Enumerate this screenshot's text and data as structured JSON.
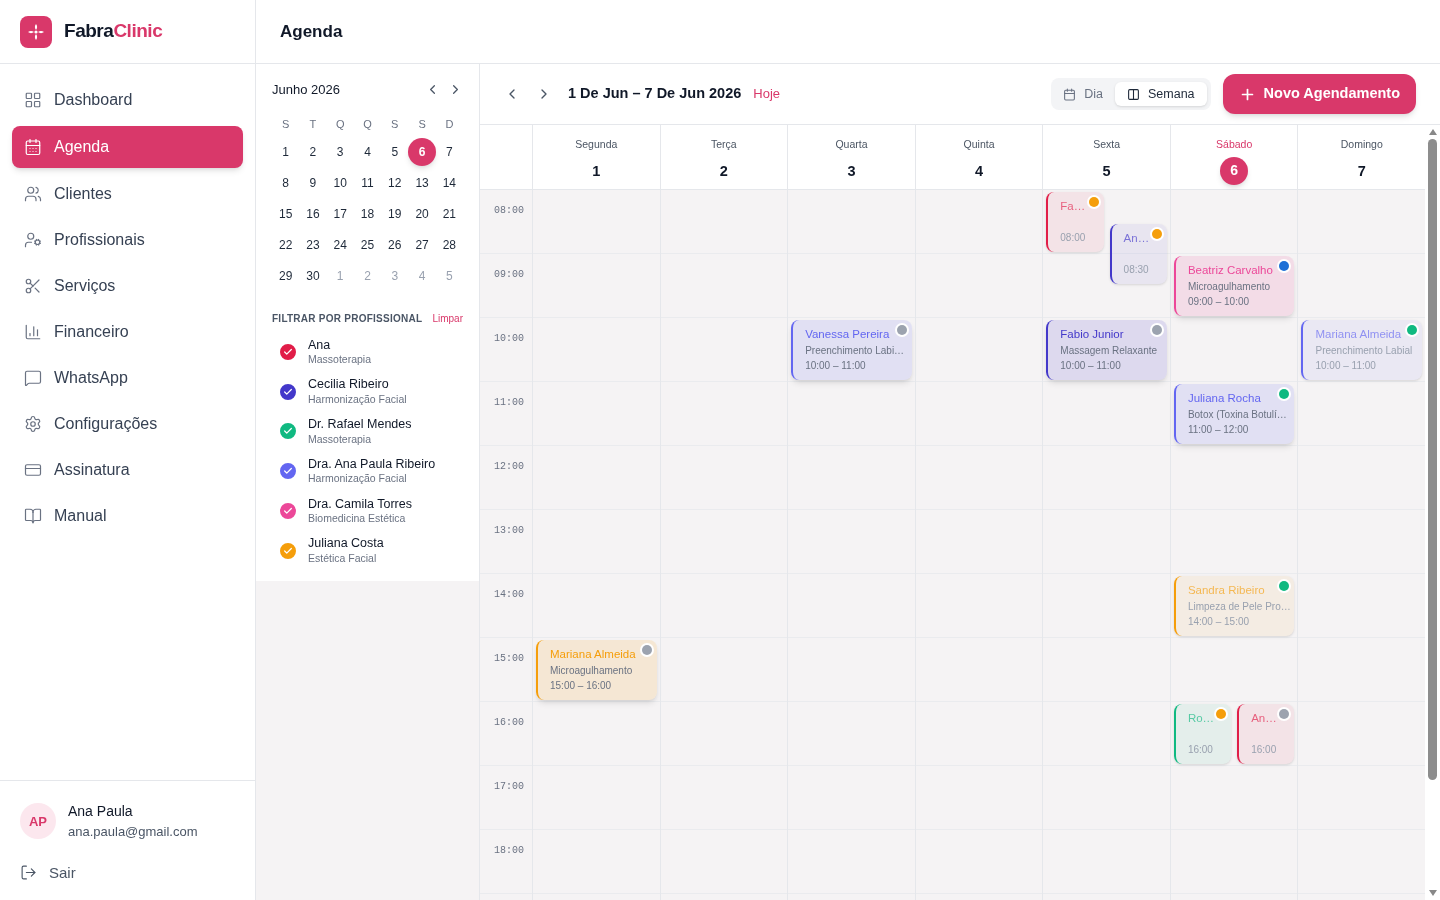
{
  "brand": {
    "first": "Fabra",
    "second": "Clinic"
  },
  "nav": [
    {
      "label": "Dashboard",
      "selected": false
    },
    {
      "label": "Agenda",
      "selected": true
    },
    {
      "label": "Clientes",
      "selected": false
    },
    {
      "label": "Profissionais",
      "selected": false
    },
    {
      "label": "Serviços",
      "selected": false
    },
    {
      "label": "Financeiro",
      "selected": false
    },
    {
      "label": "WhatsApp",
      "selected": false
    },
    {
      "label": "Configurações",
      "selected": false
    },
    {
      "label": "Assinatura",
      "selected": false
    },
    {
      "label": "Manual",
      "selected": false
    }
  ],
  "user": {
    "initials": "AP",
    "name": "Ana Paula",
    "email": "ana.paula@gmail.com",
    "logout": "Sair"
  },
  "page_title": "Agenda",
  "mini_calendar": {
    "month": "Junho 2026",
    "weekdays": [
      "S",
      "T",
      "Q",
      "Q",
      "S",
      "S",
      "D"
    ],
    "weeks": [
      [
        {
          "day": "1",
          "muted": false,
          "selected": false
        },
        {
          "day": "2",
          "muted": false,
          "selected": false
        },
        {
          "day": "3",
          "muted": false,
          "selected": false
        },
        {
          "day": "4",
          "muted": false,
          "selected": false
        },
        {
          "day": "5",
          "muted": false,
          "selected": false
        },
        {
          "day": "6",
          "muted": false,
          "selected": true
        },
        {
          "day": "7",
          "muted": false,
          "selected": false
        }
      ],
      [
        {
          "day": "8",
          "muted": false,
          "selected": false
        },
        {
          "day": "9",
          "muted": false,
          "selected": false
        },
        {
          "day": "10",
          "muted": false,
          "selected": false
        },
        {
          "day": "11",
          "muted": false,
          "selected": false
        },
        {
          "day": "12",
          "muted": false,
          "selected": false
        },
        {
          "day": "13",
          "muted": false,
          "selected": false
        },
        {
          "day": "14",
          "muted": false,
          "selected": false
        }
      ],
      [
        {
          "day": "15",
          "muted": false,
          "selected": false
        },
        {
          "day": "16",
          "muted": false,
          "selected": false
        },
        {
          "day": "17",
          "muted": false,
          "selected": false
        },
        {
          "day": "18",
          "muted": false,
          "selected": false
        },
        {
          "day": "19",
          "muted": false,
          "selected": false
        },
        {
          "day": "20",
          "muted": false,
          "selected": false
        },
        {
          "day": "21",
          "muted": false,
          "selected": false
        }
      ],
      [
        {
          "day": "22",
          "muted": false,
          "selected": false
        },
        {
          "day": "23",
          "muted": false,
          "selected": false
        },
        {
          "day": "24",
          "muted": false,
          "selected": false
        },
        {
          "day": "25",
          "muted": false,
          "selected": false
        },
        {
          "day": "26",
          "muted": false,
          "selected": false
        },
        {
          "day": "27",
          "muted": false,
          "selected": false
        },
        {
          "day": "28",
          "muted": false,
          "selected": false
        }
      ],
      [
        {
          "day": "29",
          "muted": false,
          "selected": false
        },
        {
          "day": "30",
          "muted": false,
          "selected": false
        },
        {
          "day": "1",
          "muted": true,
          "selected": false
        },
        {
          "day": "2",
          "muted": true,
          "selected": false
        },
        {
          "day": "3",
          "muted": true,
          "selected": false
        },
        {
          "day": "4",
          "muted": true,
          "selected": false
        },
        {
          "day": "5",
          "muted": true,
          "selected": false
        }
      ]
    ]
  },
  "filter": {
    "title": "FILTRAR POR PROFISSIONAL",
    "clear": "Limpar",
    "professionals": [
      {
        "name": "Ana",
        "specialty": "Massoterapia",
        "color": "#e11d48",
        "checked": true
      },
      {
        "name": "Cecilia Ribeiro",
        "specialty": "Harmonização Facial",
        "color": "#4338ca",
        "checked": true
      },
      {
        "name": "Dr. Rafael Mendes",
        "specialty": "Massoterapia",
        "color": "#10b981",
        "checked": true
      },
      {
        "name": "Dra. Ana Paula Ribeiro",
        "specialty": "Harmonização Facial",
        "color": "#6366f1",
        "checked": true
      },
      {
        "name": "Dra. Camila Torres",
        "specialty": "Biomedicina Estética",
        "color": "#ec4899",
        "checked": true
      },
      {
        "name": "Juliana Costa",
        "specialty": "Estética Facial",
        "color": "#f59e0b",
        "checked": true
      }
    ]
  },
  "toolbar": {
    "range": "1 De Jun – 7 De Jun 2026",
    "today": "Hoje",
    "views": [
      {
        "label": "Dia",
        "selected": false
      },
      {
        "label": "Semana",
        "selected": true
      }
    ],
    "new_button": "Novo Agendamento"
  },
  "hours": [
    "08:00",
    "09:00",
    "10:00",
    "11:00",
    "12:00",
    "13:00",
    "14:00",
    "15:00",
    "16:00",
    "17:00",
    "18:00"
  ],
  "days": [
    {
      "name": "Segunda",
      "number": "1",
      "selected": false,
      "events": [
        {
          "title": "Mariana Almeida",
          "service": "Microagulhamento",
          "time": "15:00 – 16:00",
          "color": "#f59e0b",
          "dot": {
            "color": "#9ca3af"
          },
          "dimmed": false
        }
      ]
    },
    {
      "name": "Terça",
      "number": "2",
      "selected": false
    },
    {
      "name": "Quarta",
      "number": "3",
      "selected": false,
      "events": [
        {
          "title": "Vanessa Pereira",
          "service": "Preenchimento Labi…",
          "time": "10:00 – 11:00",
          "color": "#6366f1",
          "dot": {
            "color": "#9ca3af"
          },
          "dimmed": false
        }
      ]
    },
    {
      "name": "Quinta",
      "number": "4",
      "selected": false
    },
    {
      "name": "Sexta",
      "number": "5",
      "selected": false,
      "events": [
        {
          "title": "Fa…",
          "time": "08:00",
          "color": "#e11d48",
          "dot": {
            "color": "#f59e0b"
          },
          "dimmed": true
        },
        {
          "title": "An…",
          "time": "08:30",
          "color": "#4338ca",
          "dot": {
            "color": "#f59e0b"
          },
          "dimmed": true
        },
        {
          "title": "Fabio Junior",
          "service": "Massagem Relaxante",
          "time": "10:00 – 11:00",
          "color": "#4338ca",
          "dot": {
            "color": "#9ca3af"
          },
          "dimmed": false
        }
      ]
    },
    {
      "name": "Sábado",
      "number": "6",
      "selected": true,
      "events": [
        {
          "title": "Beatriz Carvalho",
          "service": "Microagulhamento",
          "time": "09:00 – 10:00",
          "color": "#ec4899",
          "dot": {
            "color": "#1d6fd6"
          },
          "dimmed": false
        },
        {
          "title": "Juliana Rocha",
          "service": "Botox (Toxina Botulí…",
          "time": "11:00 – 12:00",
          "color": "#6366f1",
          "dot": {
            "color": "#10b981"
          },
          "dimmed": false
        },
        {
          "title": "Sandra Ribeiro",
          "service": "Limpeza de Pele Pro…",
          "time": "14:00 – 15:00",
          "color": "#f59e0b",
          "dot": {
            "color": "#10b981"
          },
          "dimmed": true
        },
        {
          "title": "Ro…",
          "time": "16:00",
          "color": "#10b981",
          "dot": {
            "color": "#f59e0b"
          },
          "dimmed": true
        },
        {
          "title": "An…",
          "time": "16:00",
          "color": "#e11d48",
          "dot": {
            "color": "#9ca3af"
          },
          "dimmed": true
        }
      ]
    },
    {
      "name": "Domingo",
      "number": "7",
      "selected": false,
      "events": [
        {
          "title": "Mariana Almeida",
          "service": "Preenchimento Labial",
          "time": "10:00 – 11:00",
          "color": "#6366f1",
          "dot": {
            "color": "#10b981"
          },
          "dimmed": true
        }
      ]
    }
  ]
}
